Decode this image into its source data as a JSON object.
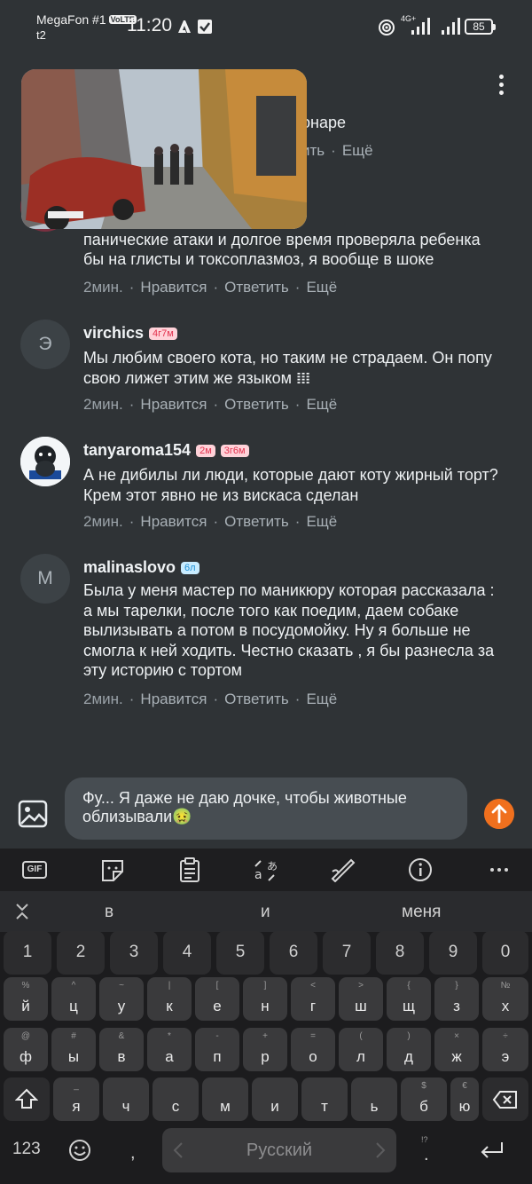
{
  "status_bar": {
    "carrier": "MegaFon #1",
    "volte": "VoLTE",
    "sim2": "t2",
    "time": "11:20",
    "network": "4G+",
    "battery": "85"
  },
  "partial_comment": {
    "header_fragment": "онаре",
    "actions_visible": [
      "ить",
      "Ещё"
    ],
    "text": "и бы после такого\nпанические атаки и долгое время проверяла ребенка\nбы на глисты и токсоплазмоз, я вообще в шоке",
    "time": "2мин.",
    "like": "Нравится",
    "reply": "Ответить",
    "more": "Ещё"
  },
  "comments": [
    {
      "avatar_letter": "Э",
      "username": "virchics",
      "badges": [
        {
          "text": "4г7м",
          "style": "pink"
        }
      ],
      "text": "Мы любим своего кота, но таким не страдаем. Он попу\nсвою лижет этим же языком 𝍖",
      "time": "2мин.",
      "like": "Нравится",
      "reply": "Ответить",
      "more": "Ещё"
    },
    {
      "avatar_letter": "",
      "username": "tanyaroma154",
      "badges": [
        {
          "text": "2м",
          "style": "pink"
        },
        {
          "text": "3г6м",
          "style": "pink"
        }
      ],
      "text": "А не дибилы ли люди, которые дают коту жирный торт?\nКрем этот явно не из вискаса сделан",
      "time": "2мин.",
      "like": "Нравится",
      "reply": "Ответить",
      "more": "Ещё"
    },
    {
      "avatar_letter": "М",
      "username": "malinaslovo",
      "badges": [
        {
          "text": "6л",
          "style": "blue"
        }
      ],
      "text": "Была у меня мастер по маникюру которая рассказала :\nа мы тарелки, после того как поедим, даем собаке\nвылизывать а потом в посудомойку. Ну я больше не\nсмогла к ней ходить. Честно сказать , я бы разнесла за\nэту историю с  тортом",
      "time": "2мин.",
      "like": "Нравится",
      "reply": "Ответить",
      "more": "Ещё"
    }
  ],
  "reply_input": {
    "value": "Фу... Я даже не даю дочке, чтобы животные\nоблизывали🤢"
  },
  "keyboard": {
    "toolbar": [
      "GIF",
      "sticker-icon",
      "clipboard-icon",
      "translate-icon",
      "handwriting-icon",
      "info-icon",
      "more-icon"
    ],
    "gif_label": "GIF",
    "suggestions": [
      "в",
      "и",
      "меня"
    ],
    "number_row": [
      "1",
      "2",
      "3",
      "4",
      "5",
      "6",
      "7",
      "8",
      "9",
      "0"
    ],
    "row1": [
      [
        "%",
        "й"
      ],
      [
        "^",
        "ц"
      ],
      [
        "~",
        "у"
      ],
      [
        "|",
        "к"
      ],
      [
        "[",
        "е"
      ],
      [
        "]",
        "н"
      ],
      [
        "<",
        "г"
      ],
      [
        ">",
        "ш"
      ],
      [
        "{",
        "щ"
      ],
      [
        "}",
        "з"
      ],
      [
        "№",
        "х"
      ]
    ],
    "row2": [
      [
        "@",
        "ф"
      ],
      [
        "#",
        "ы"
      ],
      [
        "&",
        "в"
      ],
      [
        "*",
        "а"
      ],
      [
        "-",
        "п"
      ],
      [
        "+",
        "р"
      ],
      [
        "=",
        "о"
      ],
      [
        "(",
        "л"
      ],
      [
        ")",
        "д"
      ],
      [
        "×",
        "ж"
      ],
      [
        "÷",
        "э"
      ]
    ],
    "row3": [
      [
        "_",
        "я"
      ],
      [
        "",
        "ч"
      ],
      [
        "",
        "с"
      ],
      [
        "",
        "м"
      ],
      [
        "",
        "и"
      ],
      [
        "",
        "т"
      ],
      [
        "",
        "ь"
      ],
      [
        "$",
        "б"
      ],
      [
        "€",
        "ю"
      ]
    ],
    "symbols_key": "123",
    "comma": ",",
    "period": ".",
    "period_sec": "!?",
    "space_label": "Русский"
  }
}
